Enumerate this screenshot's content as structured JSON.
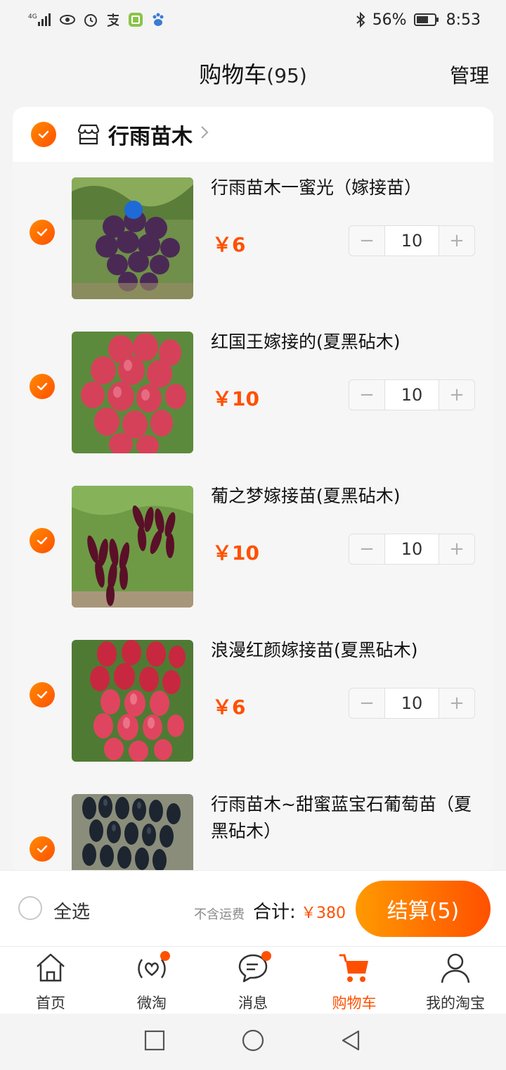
{
  "status_bar": {
    "network": "4G",
    "battery": "56%",
    "time": "8:53"
  },
  "header": {
    "title": "购物车",
    "count": "(95)",
    "manage": "管理"
  },
  "shop": {
    "name": "行雨苗木",
    "icon": "store-icon"
  },
  "items": [
    {
      "title": "行雨苗木一蜜光（嫁接苗）",
      "price": "￥6",
      "qty": "10",
      "image": "dark-purple-grape"
    },
    {
      "title": "红国王嫁接的(夏黑砧木)",
      "price": "￥10",
      "qty": "10",
      "image": "red-grape"
    },
    {
      "title": "葡之梦嫁接苗(夏黑砧木)",
      "price": "￥10",
      "qty": "10",
      "image": "finger-purple-grape"
    },
    {
      "title": "浪漫红颜嫁接苗(夏黑砧木)",
      "price": "￥6",
      "qty": "10",
      "image": "pink-red-grape"
    },
    {
      "title": "行雨苗木~甜蜜蓝宝石葡萄苗（夏黑砧木）",
      "price": "",
      "qty": "",
      "image": "blue-sapphire-grape"
    }
  ],
  "stepper": {
    "minus": "−",
    "plus": "+"
  },
  "checkout": {
    "select_all": "全选",
    "shipping_note": "不含运费",
    "total_label": "合计:",
    "total_value": "￥380",
    "button": "结算(5)"
  },
  "tabs": [
    {
      "label": "首页",
      "icon": "home-icon"
    },
    {
      "label": "微淘",
      "icon": "weitao-icon"
    },
    {
      "label": "消息",
      "icon": "message-icon"
    },
    {
      "label": "购物车",
      "icon": "cart-icon"
    },
    {
      "label": "我的淘宝",
      "icon": "profile-icon"
    }
  ],
  "colors": {
    "accent": "#ff5000",
    "accent_light": "#ff9a00"
  }
}
